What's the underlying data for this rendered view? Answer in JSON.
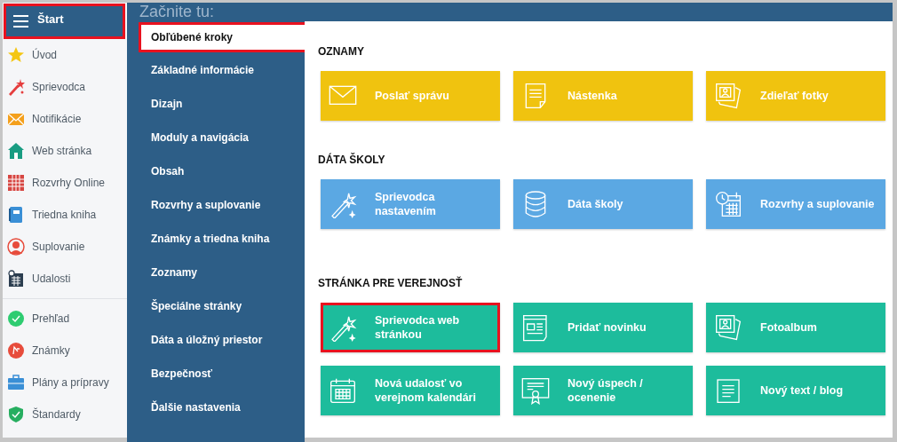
{
  "sidebar": {
    "header": {
      "label": "Štart",
      "highlighted": true
    },
    "groups": [
      [
        {
          "label": "Úvod"
        },
        {
          "label": "Sprievodca"
        },
        {
          "label": "Notifikácie"
        },
        {
          "label": "Web stránka"
        },
        {
          "label": "Rozvrhy Online"
        },
        {
          "label": "Triedna kniha"
        },
        {
          "label": "Suplovanie"
        },
        {
          "label": "Udalosti"
        }
      ],
      [
        {
          "label": "Prehľad"
        },
        {
          "label": "Známky"
        },
        {
          "label": "Plány a prípravy"
        },
        {
          "label": "Štandardy"
        }
      ]
    ]
  },
  "header": {
    "title": "Začnite tu:"
  },
  "menu": [
    {
      "label": "Obľúbené kroky",
      "selected": true,
      "highlighted": true
    },
    {
      "label": "Základné informácie",
      "selected": false,
      "highlighted": false
    },
    {
      "label": "Dizajn",
      "selected": false,
      "highlighted": false
    },
    {
      "label": "Moduly a navigácia",
      "selected": false,
      "highlighted": false
    },
    {
      "label": "Obsah",
      "selected": false,
      "highlighted": false
    },
    {
      "label": "Rozvrhy a suplovanie",
      "selected": false,
      "highlighted": false
    },
    {
      "label": "Známky a triedna kniha",
      "selected": false,
      "highlighted": false
    },
    {
      "label": "Zoznamy",
      "selected": false,
      "highlighted": false
    },
    {
      "label": "Špeciálne stránky",
      "selected": false,
      "highlighted": false
    },
    {
      "label": "Dáta a úložný priestor",
      "selected": false,
      "highlighted": false
    },
    {
      "label": "Bezpečnosť",
      "selected": false,
      "highlighted": false
    },
    {
      "label": "Ďalšie nastavenia",
      "selected": false,
      "highlighted": false
    }
  ],
  "sections": [
    {
      "title": "OZNAMY",
      "color": "#f0c30f",
      "tiles": [
        {
          "label": "Poslať správu",
          "highlighted": false
        },
        {
          "label": "Nástenka",
          "highlighted": false
        },
        {
          "label": "Zdieľať fotky",
          "highlighted": false
        }
      ]
    },
    {
      "title": "DÁTA ŠKOLY",
      "color": "#5ba8e3",
      "tiles": [
        {
          "label": "Sprievodca nastavením",
          "highlighted": false
        },
        {
          "label": "Dáta školy",
          "highlighted": false
        },
        {
          "label": "Rozvrhy a suplovanie",
          "highlighted": false
        }
      ]
    },
    {
      "title": "STRÁNKA PRE VEREJNOSŤ",
      "color": "#1dbc9c",
      "tiles": [
        {
          "label": "Sprievodca web stránkou",
          "highlighted": true
        },
        {
          "label": "Pridať novinku",
          "highlighted": false
        },
        {
          "label": "Fotoalbum",
          "highlighted": false
        },
        {
          "label": "Nová udalosť vo verejnom kalendári",
          "highlighted": false
        },
        {
          "label": "Nový úspech / ocenenie",
          "highlighted": false
        },
        {
          "label": "Nový text / blog",
          "highlighted": false
        }
      ]
    }
  ]
}
